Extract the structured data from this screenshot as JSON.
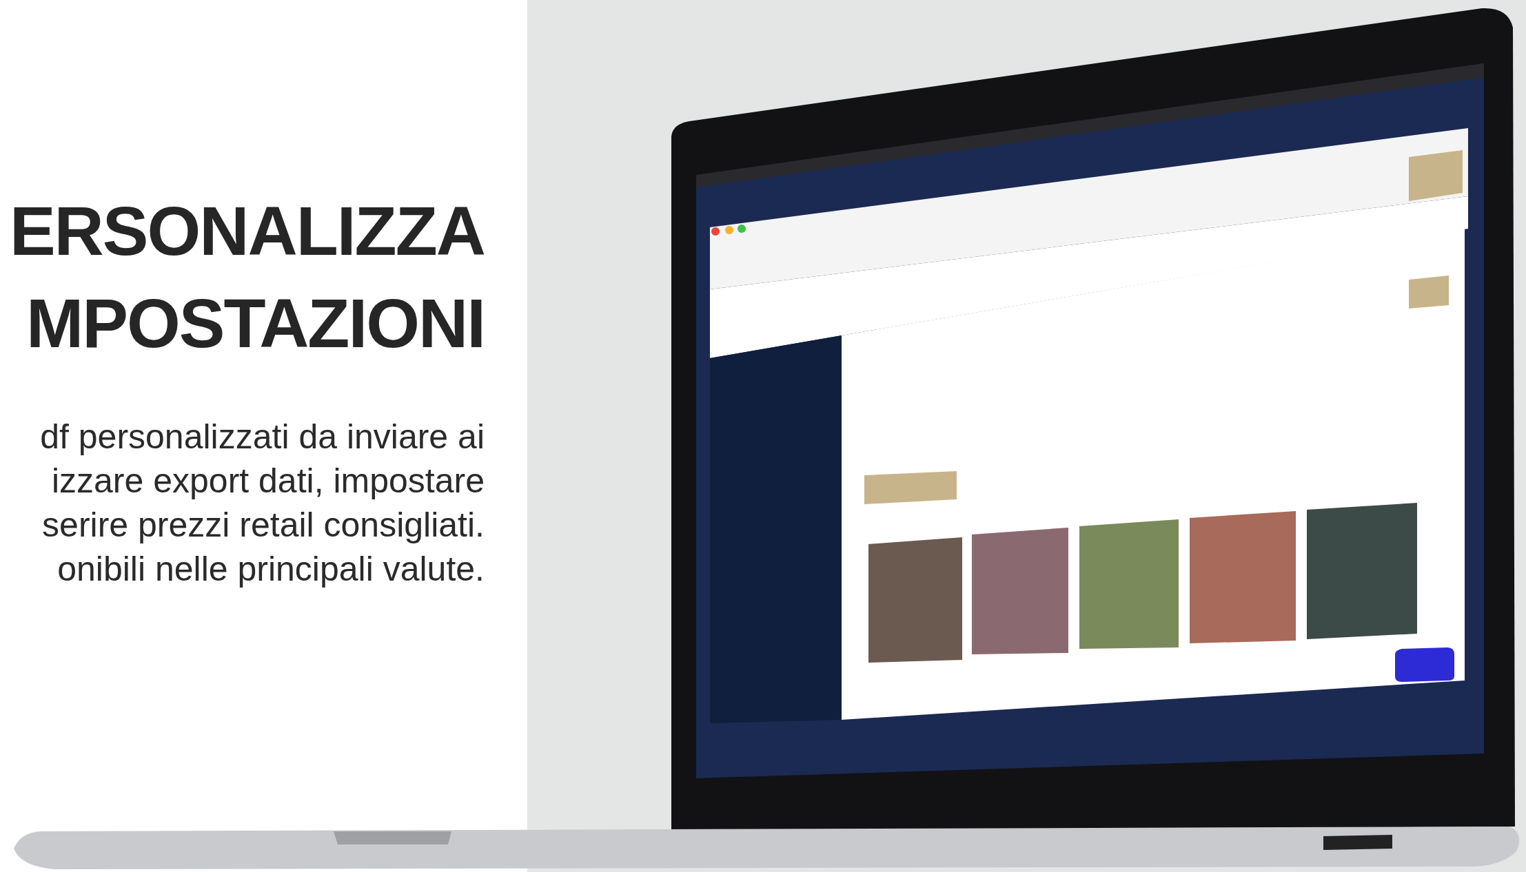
{
  "heading": {
    "lines": [
      "ERSONALIZZA",
      "MPOSTAZIONI"
    ]
  },
  "description": {
    "lines": [
      "df personalizzati da inviare ai",
      "izzare export dati, impostare",
      "serire prezzi retail consigliati.",
      "onibili nelle principali valute."
    ]
  }
}
